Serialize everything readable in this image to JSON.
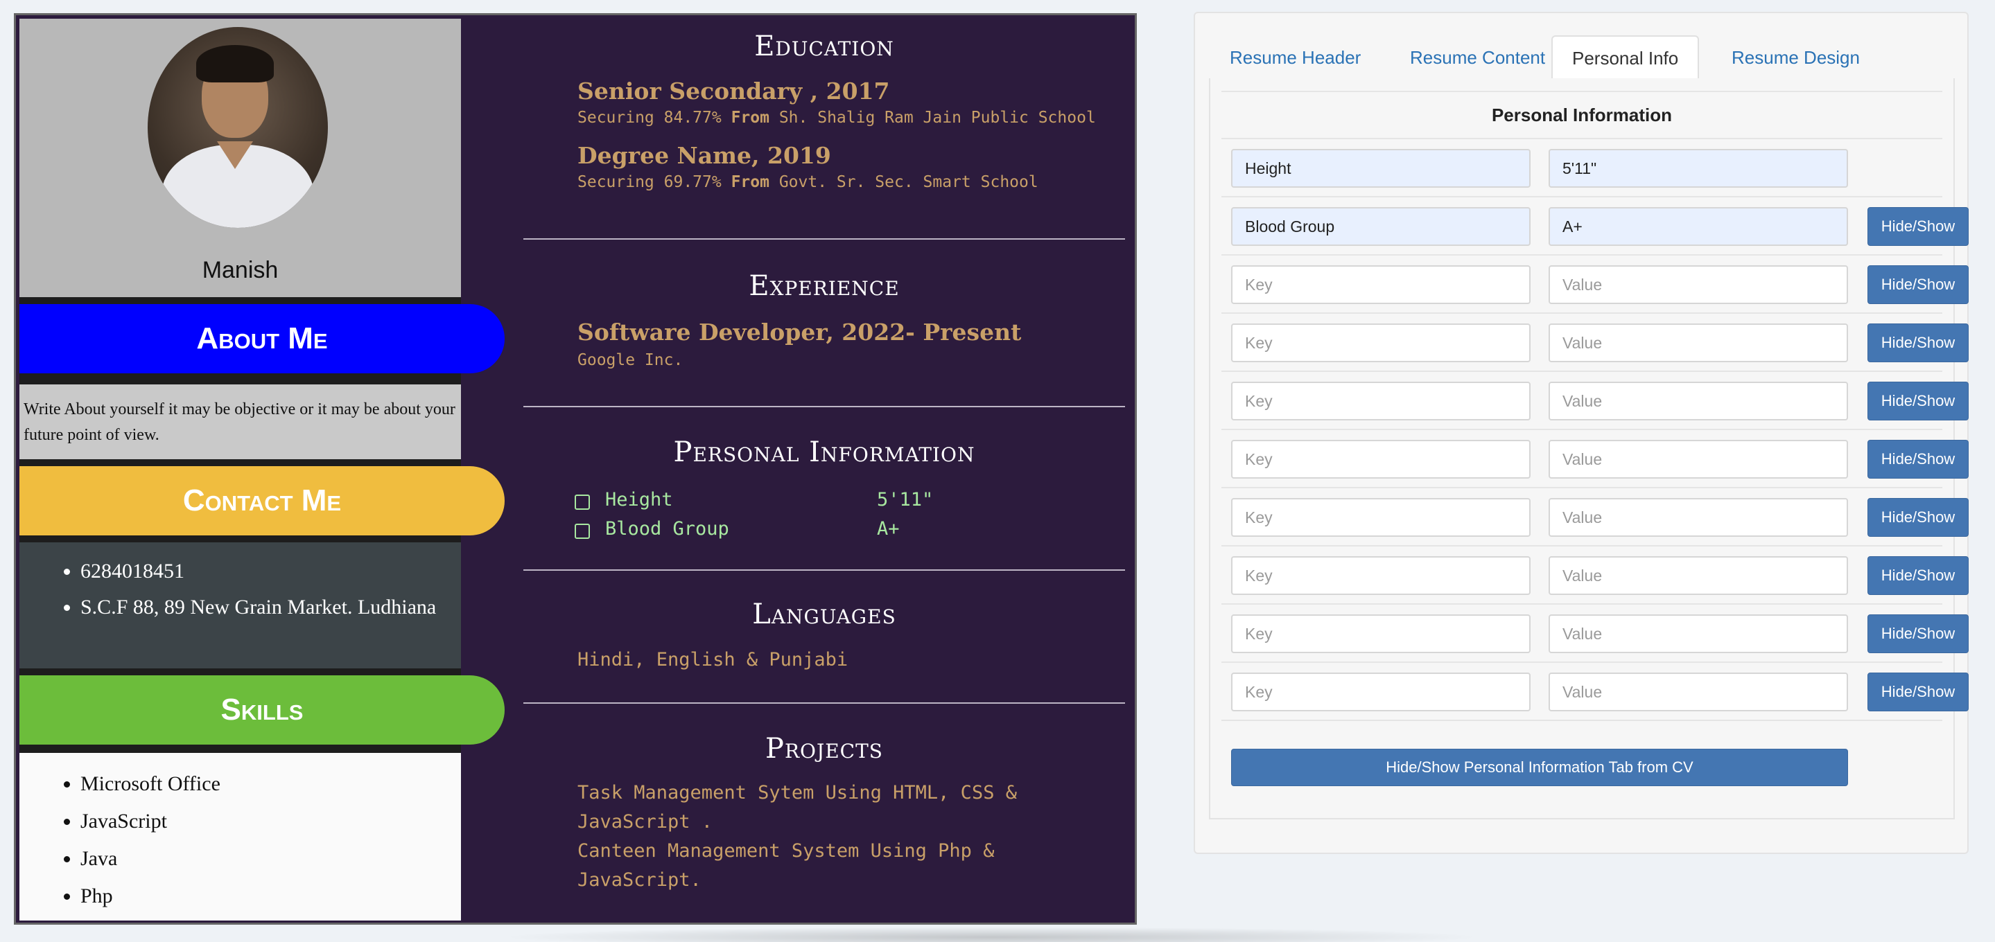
{
  "resume": {
    "name": "Manish",
    "about": {
      "title": "About Me",
      "text": "Write About yourself it may be objective or it may be about your future point of view."
    },
    "contact": {
      "title": "Contact Me",
      "items": [
        "6284018451",
        "S.C.F 88, 89 New Grain Market. Ludhiana"
      ]
    },
    "skills": {
      "title": "Skills",
      "items": [
        "Microsoft Office",
        "JavaScript",
        "Java",
        "Php"
      ]
    },
    "education": {
      "title": "Education",
      "entries": [
        {
          "title": "Senior Secondary , 2017",
          "score": "Securing 84.77%",
          "from_label": "From",
          "school": "Sh. Shalig Ram Jain Public School"
        },
        {
          "title": "Degree Name, 2019",
          "score": "Securing 69.77%",
          "from_label": "From",
          "school": "Govt. Sr. Sec. Smart School"
        }
      ]
    },
    "experience": {
      "title": "Experience",
      "entries": [
        {
          "title": "Software Developer, 2022- Present",
          "company": "Google Inc."
        }
      ]
    },
    "personal_info": {
      "title": "Personal Information",
      "rows": [
        {
          "key": "Height",
          "value": "5'11\""
        },
        {
          "key": "Blood Group",
          "value": "A+"
        }
      ]
    },
    "languages": {
      "title": "Languages",
      "text": "Hindi, English & Punjabi"
    },
    "projects": {
      "title": "Projects",
      "items": [
        "Task Management Sytem Using HTML, CSS & JavaScript .",
        "Canteen Management System Using Php & JavaScript."
      ]
    }
  },
  "editor": {
    "tabs": [
      "Resume Header",
      "Resume Content",
      "Personal Info",
      "Resume Design"
    ],
    "active_tab": "Personal Info",
    "section_title": "Personal Information",
    "key_placeholder": "Key",
    "value_placeholder": "Value",
    "hide_show_label": "Hide/Show",
    "rows": [
      {
        "key": "Height",
        "value": "5'11\"",
        "has_button": false
      },
      {
        "key": "Blood Group",
        "value": "A+",
        "has_button": true
      },
      {
        "key": "",
        "value": "",
        "has_button": true
      },
      {
        "key": "",
        "value": "",
        "has_button": true
      },
      {
        "key": "",
        "value": "",
        "has_button": true
      },
      {
        "key": "",
        "value": "",
        "has_button": true
      },
      {
        "key": "",
        "value": "",
        "has_button": true
      },
      {
        "key": "",
        "value": "",
        "has_button": true
      },
      {
        "key": "",
        "value": "",
        "has_button": true
      },
      {
        "key": "",
        "value": "",
        "has_button": true
      }
    ],
    "toggle_tab_button": "Hide/Show Personal Information Tab from CV"
  },
  "colors": {
    "resume_bg": "#2c1b3d",
    "about_pill": "#0000ff",
    "contact_pill": "#f0bd3f",
    "skills_pill": "#6cbd3b",
    "gold_text": "#c9a068",
    "green_text": "#a8e8a0",
    "button_blue": "#4476b2"
  }
}
